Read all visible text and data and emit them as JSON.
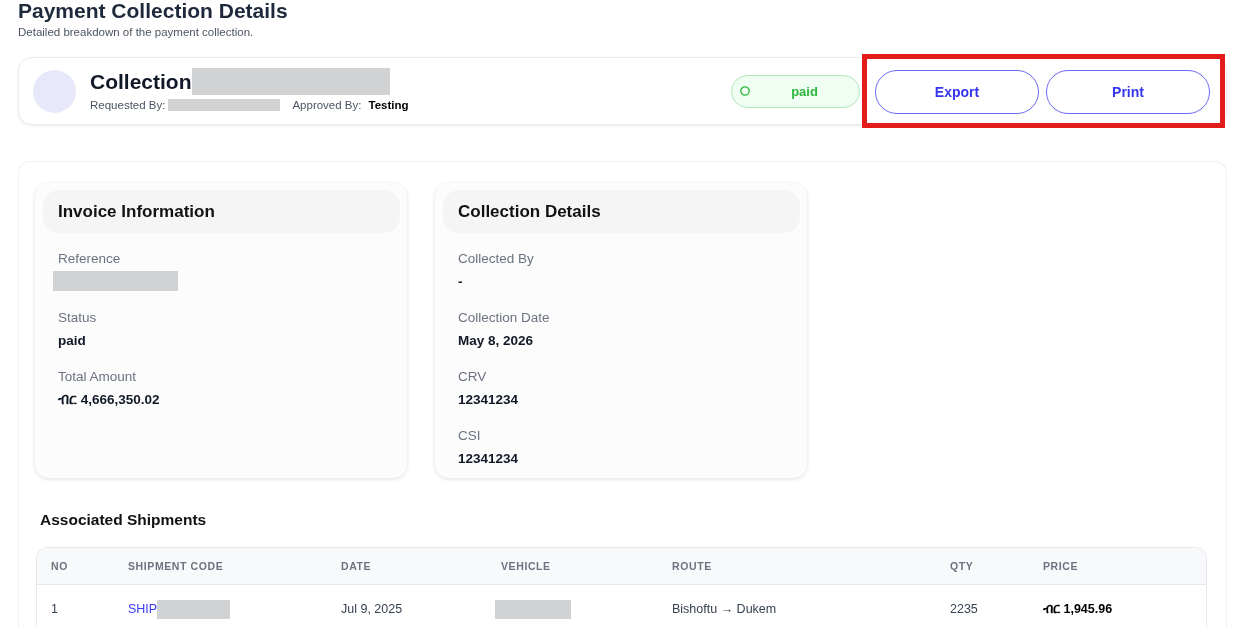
{
  "page": {
    "title": "Payment Collection Details",
    "subtitle": "Detailed breakdown of the payment collection."
  },
  "summary": {
    "title": "Collection",
    "title_redacted": true,
    "requested_by": {
      "label": "Requested By:",
      "redacted": true
    },
    "approved_by": {
      "label": "Approved By:",
      "value": "Testing"
    },
    "status_badge": {
      "label": "paid",
      "kind": "success"
    },
    "actions": {
      "highlighted": true,
      "buttons": [
        {
          "label": "Export"
        },
        {
          "label": "Print"
        }
      ]
    }
  },
  "cards": [
    {
      "title": "Invoice Information",
      "fields": [
        {
          "label": "Reference",
          "redacted": true
        },
        {
          "label": "Status",
          "value": "paid"
        },
        {
          "label": "Total Amount",
          "value": "ብር 4,666,350.02"
        }
      ]
    },
    {
      "title": "Collection Details",
      "fields": [
        {
          "label": "Collected By",
          "value": "-"
        },
        {
          "label": "Collection Date",
          "value": "May 8, 2026"
        },
        {
          "label": "CRV",
          "value": "12341234"
        },
        {
          "label": "CSI",
          "value": "12341234"
        }
      ]
    }
  ],
  "shipments": {
    "title": "Associated Shipments",
    "columns": [
      "NO",
      "SHIPMENT CODE",
      "DATE",
      "VEHICLE",
      "ROUTE",
      "QTY",
      "PRICE"
    ],
    "rows": [
      {
        "cells": [
          {
            "kind": "text",
            "text": "1"
          },
          {
            "kind": "link",
            "text": "SHIP",
            "redacted": true
          },
          {
            "kind": "text",
            "text": "Jul 9, 2025"
          },
          {
            "kind": "text",
            "redacted": true
          },
          {
            "kind": "text",
            "text": "Bishoftu → Dukem"
          },
          {
            "kind": "text",
            "text": "2235"
          },
          {
            "kind": "amount",
            "text": "ብር 1,945.96"
          }
        ]
      }
    ]
  }
}
